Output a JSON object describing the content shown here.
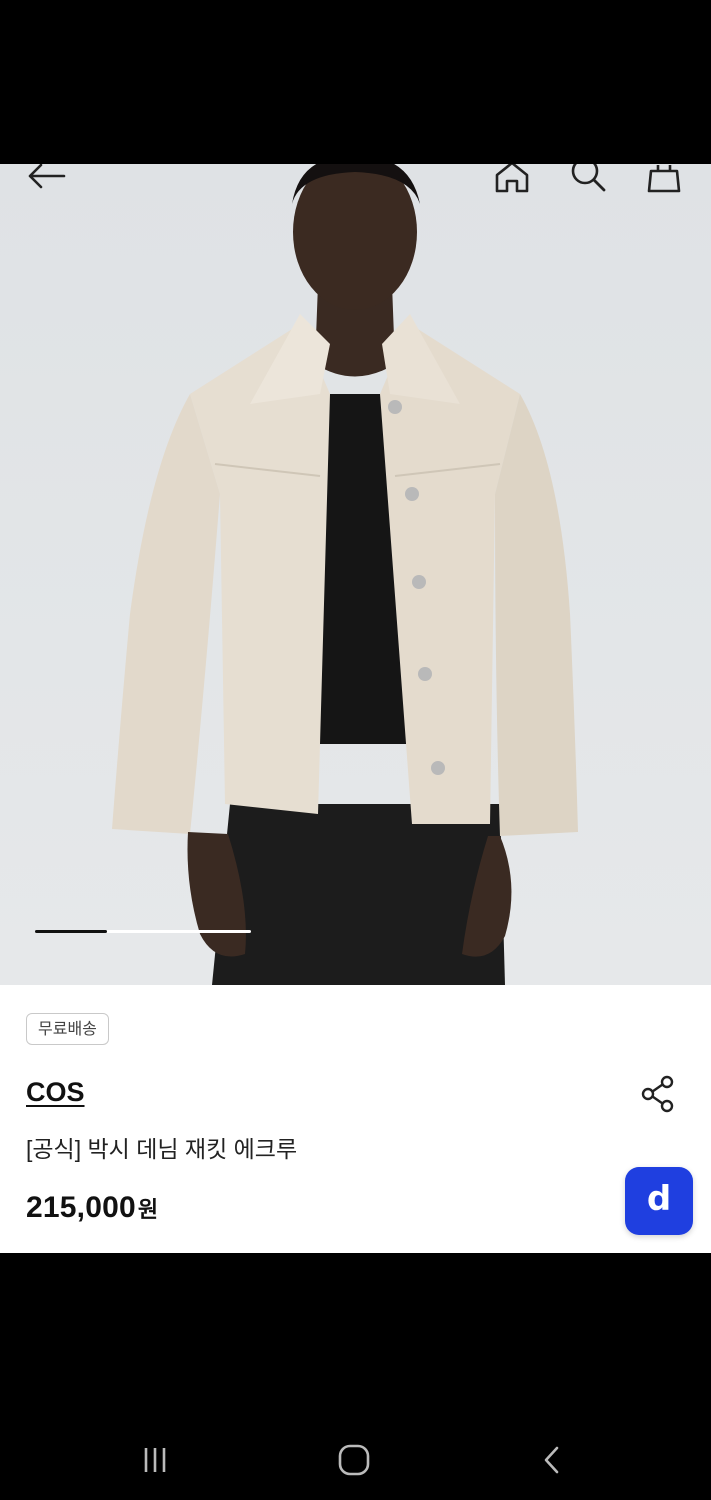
{
  "header": {
    "icons": [
      "back-arrow-icon",
      "home-icon",
      "search-icon",
      "shopping-bag-icon"
    ]
  },
  "gallery": {
    "current_index": 1,
    "total": 3
  },
  "product": {
    "badge": "무료배송",
    "brand": "COS",
    "title": "[공식] 박시 데님 재킷 에크루",
    "price": "215,000",
    "price_unit": "원",
    "app_button_label": "d"
  },
  "colors": {
    "app_button": "#1f3fe0",
    "background_photo": "#e1e4e6"
  },
  "system_nav": {
    "icons": [
      "recent-apps-icon",
      "home-circle-icon",
      "back-chevron-icon"
    ]
  }
}
